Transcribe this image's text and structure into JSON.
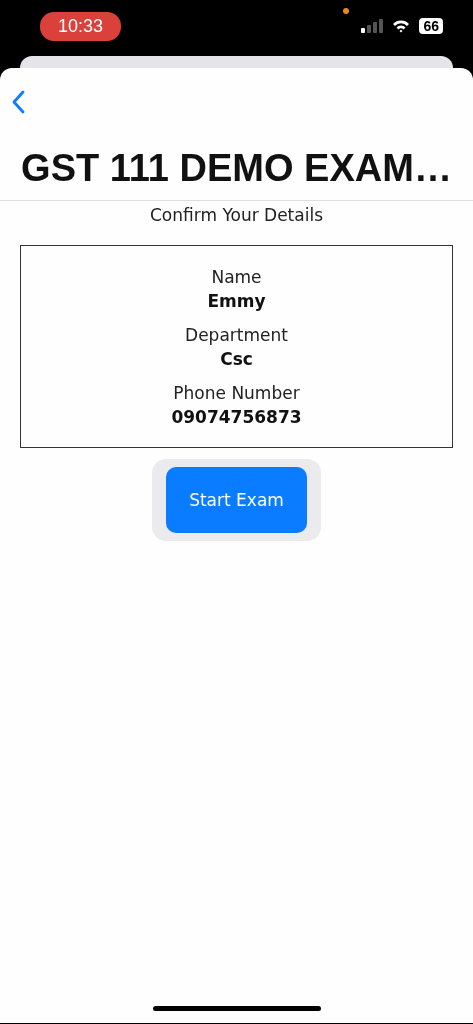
{
  "status_bar": {
    "time": "10:33",
    "battery": "66"
  },
  "header": {
    "title": "GST 111 DEMO EXAM…"
  },
  "subtitle": "Confirm Your Details",
  "details": [
    {
      "label": "Name",
      "value": "Emmy"
    },
    {
      "label": "Department",
      "value": "Csc"
    },
    {
      "label": "Phone Number",
      "value": "09074756873"
    }
  ],
  "button": "Start Exam"
}
